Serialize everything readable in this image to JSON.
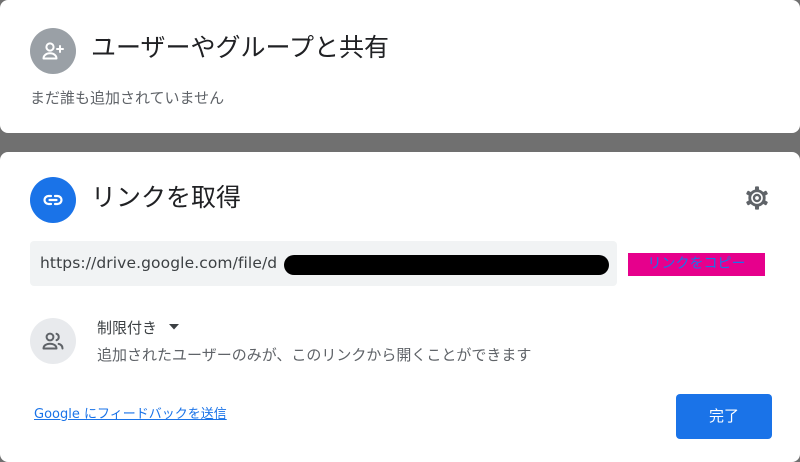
{
  "share_people": {
    "title": "ユーザーやグループと共有",
    "empty_message": "まだ誰も追加されていません",
    "icon": "person-add-icon"
  },
  "get_link": {
    "title": "リンクを取得",
    "link_icon": "link-icon",
    "settings_icon": "gear-icon",
    "url": "https://drive.google.com/file/d",
    "copy_link_label": "リンクをコピー",
    "access": {
      "icon": "people-icon",
      "selected": "制限付き",
      "description": "追加されたユーザーのみが、このリンクから開くことができます"
    }
  },
  "footer": {
    "feedback_label": "Google にフィードバックを送信",
    "done_label": "完了"
  },
  "colors": {
    "accent": "#1a73e8",
    "copy_highlight": "#e6008c",
    "backdrop": "#707070"
  }
}
